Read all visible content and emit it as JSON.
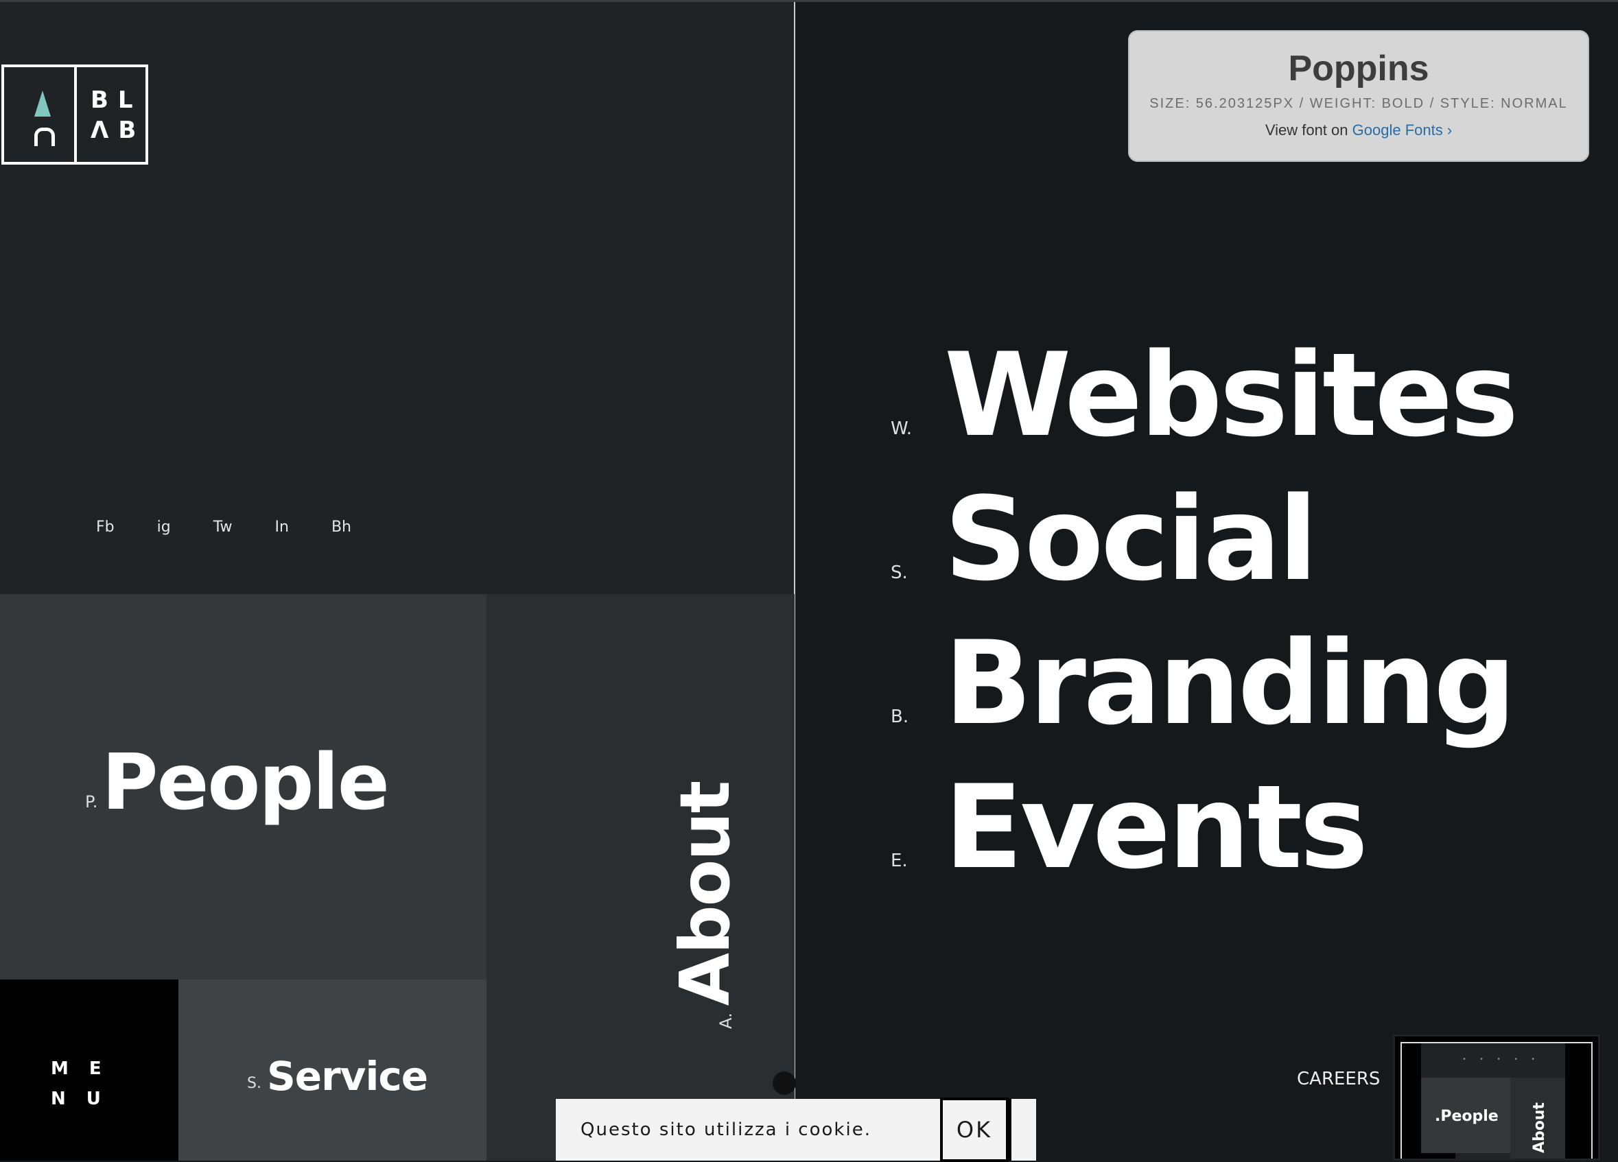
{
  "logo": {
    "letters_line1": "BL",
    "letters_line2": "ΛB"
  },
  "socials": [
    "Fb",
    "ig",
    "Tw",
    "In",
    "Bh"
  ],
  "tiles": {
    "people": {
      "prefix": "P.",
      "label": "People"
    },
    "about": {
      "prefix": "A.",
      "label": "About"
    },
    "menu": {
      "line1": "ME",
      "line2": "NU"
    },
    "service": {
      "prefix": "S.",
      "label": "Service"
    }
  },
  "services": [
    {
      "prefix": "W.",
      "label": "Websites"
    },
    {
      "prefix": "S.",
      "label": "Social"
    },
    {
      "prefix": "B.",
      "label": "Branding"
    },
    {
      "prefix": "E.",
      "label": "Events"
    }
  ],
  "careers": "CAREERS",
  "font_tooltip": {
    "name": "Poppins",
    "meta": "SIZE: 56.203125PX / WEIGHT: BOLD / STYLE: NORMAL",
    "view_prefix": "View font on",
    "view_link": "Google Fonts ›"
  },
  "cookie": {
    "message": "Questo sito utilizza i cookie.",
    "ok_label": "OK"
  },
  "minimap": {
    "people": ".People",
    "about": "About",
    "dots": "• • • • •"
  },
  "colors": {
    "accent_cone": "#7fc7bf",
    "link": "#2a6ca8",
    "bg_dark": "#16191c"
  }
}
